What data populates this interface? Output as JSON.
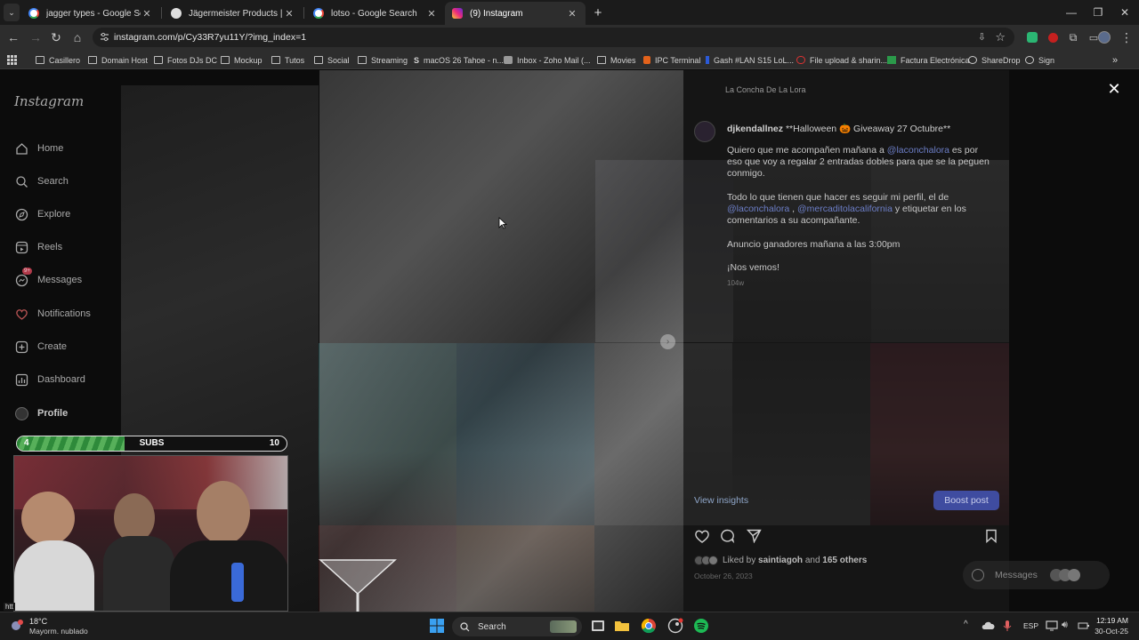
{
  "browser": {
    "tabs": [
      {
        "title": "jagger types - Google Search",
        "icon": "google-icon",
        "active": false
      },
      {
        "title": "Jägermeister Products | Jägerm",
        "icon": "jagermeister-icon",
        "active": false
      },
      {
        "title": "lotso - Google Search",
        "icon": "google-icon",
        "active": false
      },
      {
        "title": "(9) Instagram",
        "icon": "instagram-icon",
        "active": true
      }
    ],
    "new_tab_label": "+",
    "url": "instagram.com/p/Cy33R7yu11Y/?img_index=1",
    "bookmarks": [
      "Casillero",
      "Domain Host",
      "Fotos DJs DC",
      "Mockup",
      "Tutos",
      "Social",
      "Streaming",
      "macOS 26 Tahoe - n...",
      "Inbox - Zoho Mail (...",
      "Movies",
      "IPC Terminal",
      "Gash #LAN S15 LoL...",
      "File upload & sharin...",
      "Factura Electrónica",
      "ShareDrop",
      "Sign"
    ]
  },
  "instagram": {
    "logo": "Instagram",
    "nav": [
      {
        "label": "Home",
        "icon": "home-icon"
      },
      {
        "label": "Search",
        "icon": "search-icon"
      },
      {
        "label": "Explore",
        "icon": "compass-icon"
      },
      {
        "label": "Reels",
        "icon": "reels-icon"
      },
      {
        "label": "Messages",
        "icon": "messenger-icon",
        "badge": "9+"
      },
      {
        "label": "Notifications",
        "icon": "heart-icon"
      },
      {
        "label": "Create",
        "icon": "plus-square-icon"
      },
      {
        "label": "Dashboard",
        "icon": "dashboard-icon"
      },
      {
        "label": "Profile",
        "icon": "avatar"
      }
    ],
    "post": {
      "location": "La Concha De La Lora",
      "author": "djkendallnez",
      "caption_head": "**Halloween 🎃 Giveaway 27 Octubre**",
      "caption": {
        "p1_a": "Quiero que me acompañen mañana a ",
        "p1_mention": "@laconchalora",
        "p1_b": " es por eso que voy a regalar 2 entradas dobles para que se la peguen conmigo.",
        "p2_a": "Todo lo que tienen que hacer es seguir mi perfil, el de ",
        "p2_mention1": "@laconchalora",
        "p2_sep": " , ",
        "p2_mention2": "@mercaditolacalifornia",
        "p2_b": " y etiquetar en los comentarios a su acompañante.",
        "p3": "Anuncio ganadores mañana a las 3:00pm",
        "p4": "¡Nos vemos!"
      },
      "time_ago": "104w",
      "view_insights": "View insights",
      "boost_post": "Boost post",
      "liked_by_prefix": "Liked by ",
      "liked_by_user": "saintiagoh",
      "liked_by_mid": " and ",
      "liked_by_others": "165 others",
      "date": "October 26, 2023",
      "messages_label": "Messages"
    }
  },
  "stream_overlay": {
    "subs_label": "SUBS",
    "subs_current": "4",
    "subs_goal": "10",
    "subs_progress": 0.4
  },
  "taskbar": {
    "weather_temp": "18°C",
    "weather_desc": "Mayorm. nublado",
    "search_placeholder": "Search",
    "lang": "ESP",
    "time": "12:19 AM",
    "date": "30-Oct-25",
    "status_url": "htt"
  }
}
